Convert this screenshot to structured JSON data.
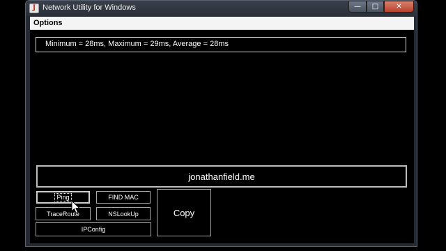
{
  "window": {
    "title": "Network Utility for Windows",
    "controls": {
      "minimize": "—",
      "maximize": "□",
      "close": "✕"
    }
  },
  "menu": {
    "options_label": "Options"
  },
  "result": {
    "text": "Minimum = 28ms, Maximum = 29ms, Average = 28ms"
  },
  "host_input": {
    "value": "jonathanfield.me"
  },
  "buttons": {
    "ping": "Ping",
    "find_mac": "FIND MAC",
    "traceroute": "TraceRoute",
    "nslookup": "NSLookUp",
    "ipconfig": "IPConfig",
    "copy": "Copy"
  },
  "icons": {
    "app": "java-cup-icon",
    "cursor": "mouse-pointer-icon"
  },
  "colors": {
    "background": "#000000",
    "titlebar": "#2e343d",
    "close_button": "#c8553e",
    "menubar": "#f4f4f4",
    "border": "#bdbdbd",
    "text": "#ffffff"
  }
}
